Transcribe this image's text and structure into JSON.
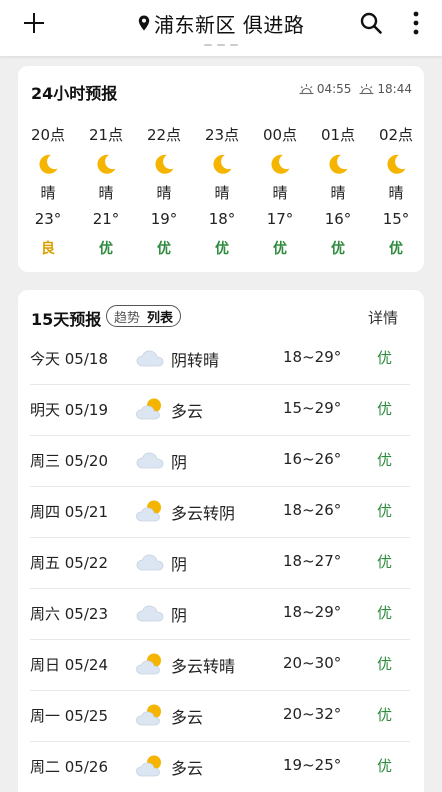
{
  "header": {
    "location": "浦东新区 俱进路"
  },
  "colors": {
    "aqi_good": "#2e8b3e",
    "aqi_fair": "#d9a000",
    "moon": "#f4b400",
    "cloud": "#dce6f2"
  },
  "hourly": {
    "title": "24小时预报",
    "sunrise": "04:55",
    "sunset": "18:44",
    "hours": [
      {
        "time": "20点",
        "icon": "moon-icon",
        "cond": "晴",
        "temp": "23°",
        "aqi": "良",
        "aqi_level": "fair"
      },
      {
        "time": "21点",
        "icon": "moon-icon",
        "cond": "晴",
        "temp": "21°",
        "aqi": "优",
        "aqi_level": "good"
      },
      {
        "time": "22点",
        "icon": "moon-icon",
        "cond": "晴",
        "temp": "19°",
        "aqi": "优",
        "aqi_level": "good"
      },
      {
        "time": "23点",
        "icon": "moon-icon",
        "cond": "晴",
        "temp": "18°",
        "aqi": "优",
        "aqi_level": "good"
      },
      {
        "time": "00点",
        "icon": "moon-icon",
        "cond": "晴",
        "temp": "17°",
        "aqi": "优",
        "aqi_level": "good"
      },
      {
        "time": "01点",
        "icon": "moon-icon",
        "cond": "晴",
        "temp": "16°",
        "aqi": "优",
        "aqi_level": "good"
      },
      {
        "time": "02点",
        "icon": "moon-icon",
        "cond": "晴",
        "temp": "15°",
        "aqi": "优",
        "aqi_level": "good"
      }
    ]
  },
  "daily": {
    "title": "15天预报",
    "toggle_trend": "趋势",
    "toggle_list": "列表",
    "detail": "详情",
    "days": [
      {
        "date": "今天 05/18",
        "icon": "cloud-icon",
        "cond": "阴转晴",
        "temp": "18~29°",
        "aqi": "优"
      },
      {
        "date": "明天 05/19",
        "icon": "partly-cloudy-icon",
        "cond": "多云",
        "temp": "15~29°",
        "aqi": "优"
      },
      {
        "date": "周三 05/20",
        "icon": "cloud-icon",
        "cond": "阴",
        "temp": "16~26°",
        "aqi": "优"
      },
      {
        "date": "周四 05/21",
        "icon": "partly-cloudy-icon",
        "cond": "多云转阴",
        "temp": "18~26°",
        "aqi": "优"
      },
      {
        "date": "周五 05/22",
        "icon": "cloud-icon",
        "cond": "阴",
        "temp": "18~27°",
        "aqi": "优"
      },
      {
        "date": "周六 05/23",
        "icon": "cloud-icon",
        "cond": "阴",
        "temp": "18~29°",
        "aqi": "优"
      },
      {
        "date": "周日 05/24",
        "icon": "partly-cloudy-icon",
        "cond": "多云转晴",
        "temp": "20~30°",
        "aqi": "优"
      },
      {
        "date": "周一 05/25",
        "icon": "partly-cloudy-icon",
        "cond": "多云",
        "temp": "20~32°",
        "aqi": "优"
      },
      {
        "date": "周二 05/26",
        "icon": "partly-cloudy-icon",
        "cond": "多云",
        "temp": "19~25°",
        "aqi": "优"
      }
    ]
  }
}
